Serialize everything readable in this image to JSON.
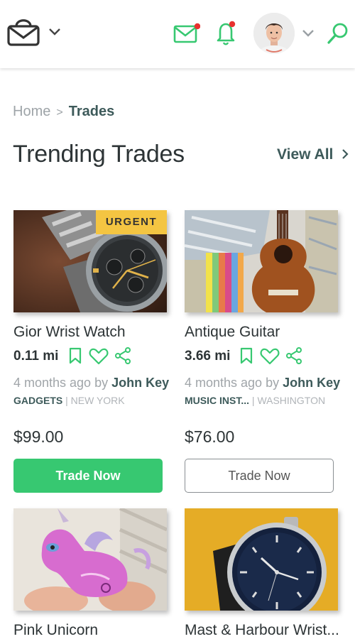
{
  "header": {
    "logo_icon": "shopping-bag-icon",
    "mail_icon": "mail-icon",
    "bell_icon": "bell-icon",
    "search_icon": "search-icon",
    "accent_color": "#37c871",
    "notification_dot_color": "#e8312f"
  },
  "breadcrumb": {
    "home": "Home",
    "separator": ">",
    "current": "Trades"
  },
  "section": {
    "title": "Trending Trades",
    "view_all": "View All"
  },
  "cards": [
    {
      "title": "Gior Wrist Watch",
      "badge": "URGENT",
      "distance": "0.11 mi",
      "posted": "4 months ago by ",
      "author": "John Key",
      "category": "GADGETS",
      "tag_sep": " | ",
      "location": "NEW YORK",
      "price": "$99.00",
      "button": "Trade Now"
    },
    {
      "title": "Antique Guitar",
      "distance": "3.66 mi",
      "posted": "4 months ago by ",
      "author": "John Key",
      "category": "MUSIC INST...",
      "tag_sep": " | ",
      "location": "WASHINGTON",
      "price": "$76.00",
      "button": "Trade Now"
    },
    {
      "title": "Pink Unicorn"
    },
    {
      "title": "Mast & Harbour Wrist..."
    }
  ]
}
